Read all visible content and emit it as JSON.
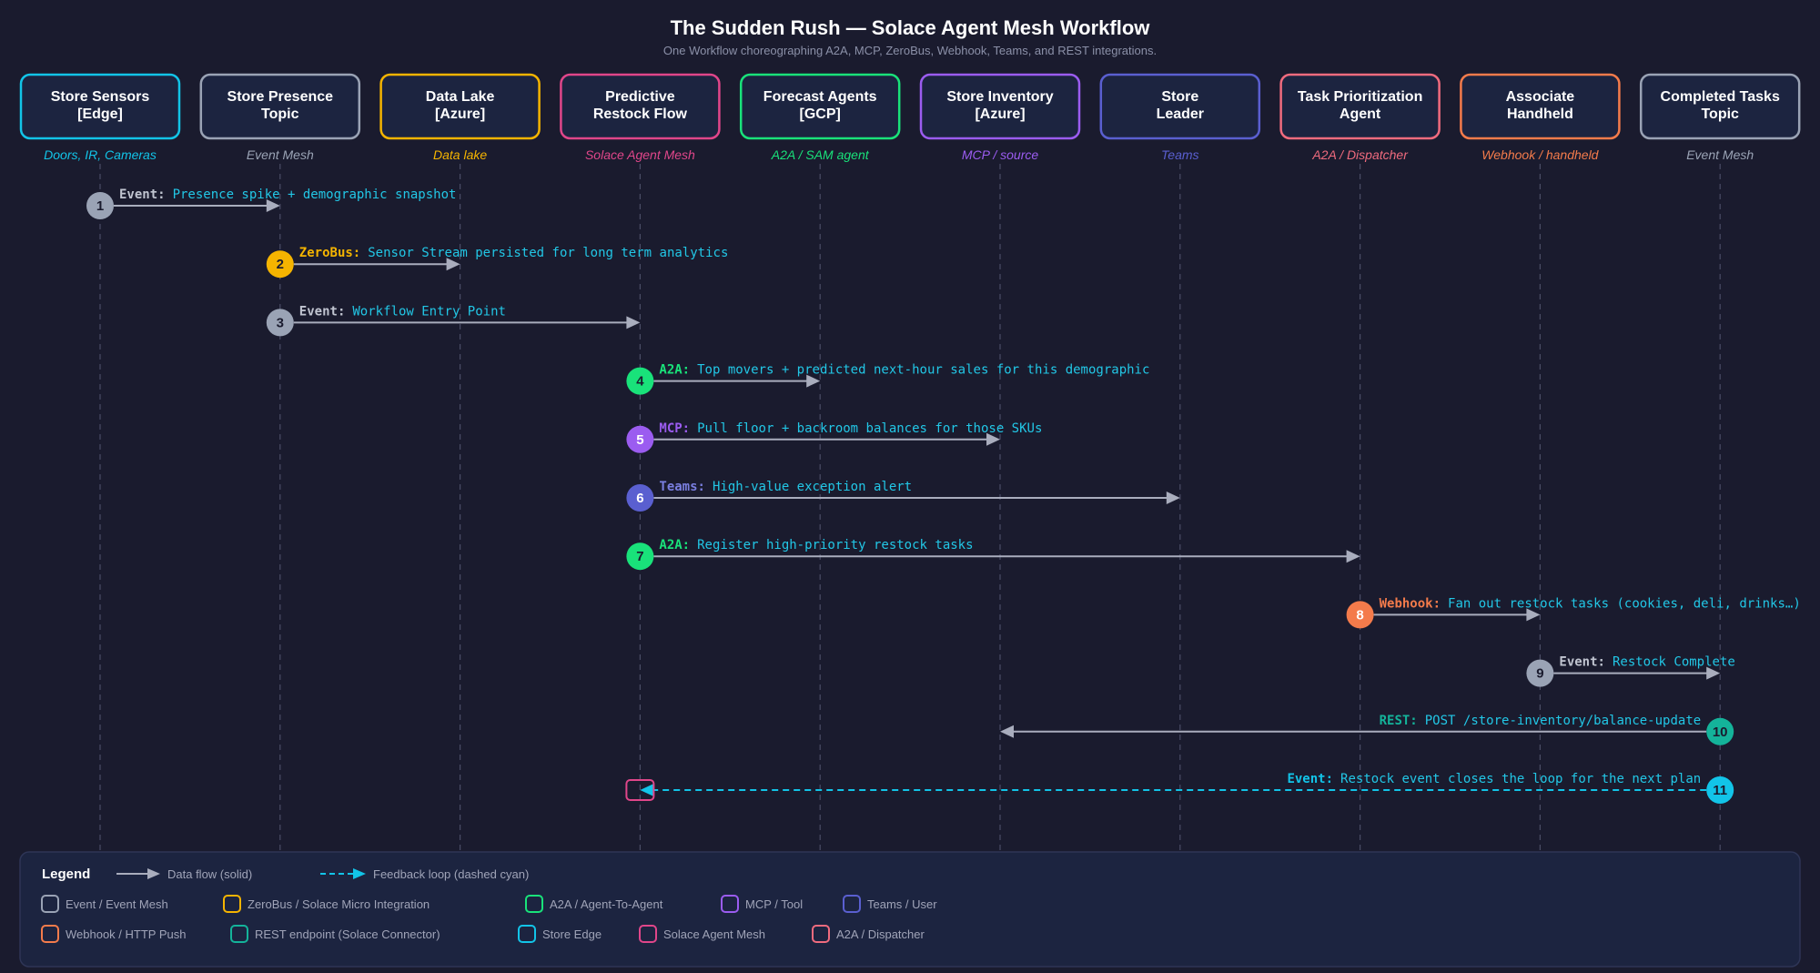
{
  "header": {
    "title": "The Sudden Rush — Solace Agent Mesh Workflow",
    "subtitle": "One Workflow choreographing A2A, MCP, ZeroBus, Webhook, Teams, and REST integrations."
  },
  "colors": {
    "background": "#1a1b2e",
    "box_fill": "#1c2440",
    "grey": "#9aa3b5",
    "yellow": "#f5b400",
    "pink": "#e0468a",
    "green": "#19e27a",
    "purple": "#9b5cf0",
    "indigo": "#5a5fd0",
    "salmon": "#f06b7e",
    "orange": "#f47b4b",
    "cyan": "#12c4e8",
    "teal": "#14b39a",
    "message_text": "#22c7e6"
  },
  "lanes": [
    {
      "id": "sensors",
      "line1": "Store Sensors",
      "line2": "[Edge]",
      "sub": "Doors, IR, Cameras",
      "color": "#12c4e8",
      "sub_color": "#12c4e8"
    },
    {
      "id": "presence",
      "line1": "Store Presence",
      "line2": "Topic",
      "sub": "Event Mesh",
      "color": "#9aa3b5",
      "sub_color": "#9aa3b5"
    },
    {
      "id": "datalake",
      "line1": "Data Lake",
      "line2": "[Azure]",
      "sub": "Data lake",
      "color": "#f5b400",
      "sub_color": "#f5b400"
    },
    {
      "id": "restock",
      "line1": "Predictive",
      "line2": "Restock Flow",
      "sub": "Solace Agent Mesh",
      "color": "#e0468a",
      "sub_color": "#e0468a"
    },
    {
      "id": "forecast",
      "line1": "Forecast Agents",
      "line2": "[GCP]",
      "sub": "A2A / SAM agent",
      "color": "#19e27a",
      "sub_color": "#19e27a"
    },
    {
      "id": "inventory",
      "line1": "Store Inventory",
      "line2": "[Azure]",
      "sub": "MCP / source",
      "color": "#9b5cf0",
      "sub_color": "#9b5cf0"
    },
    {
      "id": "leader",
      "line1": "Store",
      "line2": "Leader",
      "sub": "Teams",
      "color": "#5a5fd0",
      "sub_color": "#5a5fd0"
    },
    {
      "id": "taskprio",
      "line1": "Task Prioritization",
      "line2": "Agent",
      "sub": "A2A / Dispatcher",
      "color": "#f06b7e",
      "sub_color": "#f06b7e"
    },
    {
      "id": "handheld",
      "line1": "Associate",
      "line2": "Handheld",
      "sub": "Webhook / handheld",
      "color": "#f47b4b",
      "sub_color": "#f47b4b"
    },
    {
      "id": "completed",
      "line1": "Completed Tasks",
      "line2": "Topic",
      "sub": "Event Mesh",
      "color": "#9aa3b5",
      "sub_color": "#9aa3b5"
    }
  ],
  "steps": [
    {
      "num": "1",
      "from": 0,
      "to": 1,
      "kind": "Event:",
      "text": "Presence spike + demographic snapshot",
      "color": "#9aa3b5",
      "kind_color": "#c0c4d0"
    },
    {
      "num": "2",
      "from": 1,
      "to": 2,
      "kind": "ZeroBus:",
      "text": "Sensor Stream persisted for long term analytics",
      "color": "#f5b400",
      "kind_color": "#f5b400"
    },
    {
      "num": "3",
      "from": 1,
      "to": 3,
      "kind": "Event:",
      "text": "Workflow Entry Point",
      "color": "#9aa3b5",
      "kind_color": "#c0c4d0"
    },
    {
      "num": "4",
      "from": 3,
      "to": 4,
      "kind": "A2A:",
      "text": "Top movers + predicted next-hour sales for this demographic",
      "color": "#19e27a",
      "kind_color": "#19e27a"
    },
    {
      "num": "5",
      "from": 3,
      "to": 5,
      "kind": "MCP:",
      "text": "Pull floor + backroom balances for those SKUs",
      "color": "#9b5cf0",
      "kind_color": "#9b5cf0"
    },
    {
      "num": "6",
      "from": 3,
      "to": 6,
      "kind": "Teams:",
      "text": "High-value exception alert",
      "color": "#5a5fd0",
      "kind_color": "#7a7fe0"
    },
    {
      "num": "7",
      "from": 3,
      "to": 7,
      "kind": "A2A:",
      "text": "Register high-priority restock tasks",
      "color": "#19e27a",
      "kind_color": "#19e27a"
    },
    {
      "num": "8",
      "from": 7,
      "to": 8,
      "kind": "Webhook:",
      "text": "Fan out restock tasks (cookies, deli, drinks…)",
      "color": "#f47b4b",
      "kind_color": "#f47b4b"
    },
    {
      "num": "9",
      "from": 8,
      "to": 9,
      "kind": "Event:",
      "text": "Restock Complete",
      "color": "#9aa3b5",
      "kind_color": "#c0c4d0"
    },
    {
      "num": "10",
      "from": 9,
      "to": 5,
      "kind": "REST:",
      "text": "POST /store-inventory/balance-update",
      "color": "#14b39a",
      "kind_color": "#14b39a"
    },
    {
      "num": "11",
      "from": 9,
      "to": 3,
      "kind": "Event:",
      "text": "Restock event closes the loop for the next plan",
      "color": "#12c4e8",
      "kind_color": "#12c4e8",
      "dashed": true
    }
  ],
  "legend": {
    "title": "Legend",
    "solid_label": "Data flow (solid)",
    "dashed_label": "Feedback loop (dashed cyan)",
    "items": [
      {
        "label": "Event / Event Mesh",
        "color": "#9aa3b5"
      },
      {
        "label": "ZeroBus / Solace Micro Integration",
        "color": "#f5b400"
      },
      {
        "label": "A2A / Agent-To-Agent",
        "color": "#19e27a"
      },
      {
        "label": "MCP / Tool",
        "color": "#9b5cf0"
      },
      {
        "label": "Teams / User",
        "color": "#5a5fd0"
      },
      {
        "label": "Webhook / HTTP Push",
        "color": "#f47b4b"
      },
      {
        "label": "REST endpoint (Solace Connector)",
        "color": "#14b39a"
      },
      {
        "label": "Store Edge",
        "color": "#12c4e8"
      },
      {
        "label": "Solace Agent Mesh",
        "color": "#e0468a"
      },
      {
        "label": "A2A / Dispatcher",
        "color": "#f06b7e"
      }
    ]
  }
}
